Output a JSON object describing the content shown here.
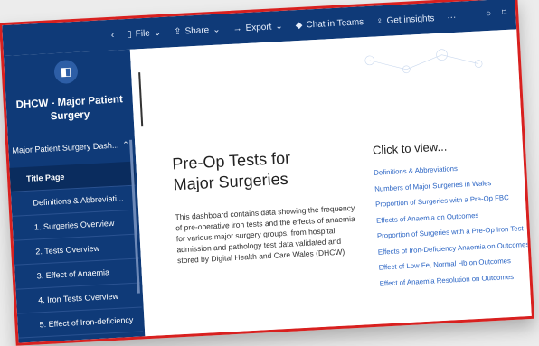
{
  "topbar": {
    "back_icon": "chevron-left-icon",
    "file": "File",
    "share": "Share",
    "export": "Export",
    "chat": "Chat in Teams",
    "insights": "Get insights",
    "more": "···"
  },
  "sidebar": {
    "logo_icon": "report-icon",
    "report_title": "DHCW - Major Patient Surgery",
    "section_label": "Major Patient Surgery Dash...",
    "items": [
      {
        "label": "Title Page"
      },
      {
        "label": "Definitions & Abbreviati..."
      },
      {
        "label": "1. Surgeries Overview"
      },
      {
        "label": "2. Tests Overview"
      },
      {
        "label": "3. Effect of Anaemia"
      },
      {
        "label": "4. Iron Tests Overview"
      },
      {
        "label": "5. Effect of Iron-deficiency"
      }
    ]
  },
  "main": {
    "title_line1": "Pre-Op Tests for",
    "title_line2": "Major Surgeries",
    "description": "This dashboard contains data showing the frequency of pre-operative iron tests and the effects of anaemia for various major surgery groups, from hospital admission and pathology test data validated and stored by Digital Health and Care Wales (DHCW)",
    "click_heading": "Click to view...",
    "links": [
      "Definitions & Abbreviations",
      "Numbers of Major Surgeries in Wales",
      "Proportion of Surgeries with a Pre-Op FBC",
      "Effects of Anaemia on Outcomes",
      "Proportion of Surgeries with a Pre-Op Iron Test",
      "Effects of Iron-Deficiency Anaemia on Outcomes",
      "Effect of Low Fe, Normal Hb on Outcomes",
      "Effect of Anaemia Resolution on Outcomes"
    ]
  },
  "colors": {
    "sidebar": "#0f3a78",
    "border": "#d8201f",
    "link": "#2a64c4"
  }
}
